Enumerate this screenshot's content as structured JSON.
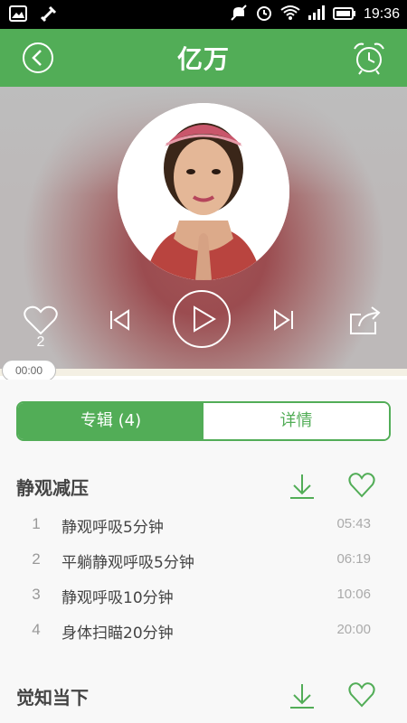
{
  "status_bar": {
    "time": "19:36",
    "icons": [
      "gallery-icon",
      "usb-icon",
      "mute-icon",
      "alarm-icon",
      "wifi-icon",
      "signal-icon",
      "battery-icon"
    ]
  },
  "header": {
    "title": "亿万",
    "back_icon": "back-icon",
    "alarm_icon": "alarm-clock-icon",
    "color": "#52ad57"
  },
  "player": {
    "like_count": "2",
    "current_time": "00:00",
    "progress": 0
  },
  "tabs": [
    {
      "label": "专辑 (4)",
      "active": true
    },
    {
      "label": "详情",
      "active": false
    }
  ],
  "albums": [
    {
      "title": "静观减压",
      "tracks": [
        {
          "num": "1",
          "name": "静观呼吸5分钟",
          "duration": "05:43"
        },
        {
          "num": "2",
          "name": "平躺静观呼吸5分钟",
          "duration": "06:19"
        },
        {
          "num": "3",
          "name": "静观呼吸10分钟",
          "duration": "10:06"
        },
        {
          "num": "4",
          "name": "身体扫瞄20分钟",
          "duration": "20:00"
        }
      ]
    },
    {
      "title": "觉知当下",
      "tracks": []
    }
  ],
  "accent_color": "#52ad57"
}
